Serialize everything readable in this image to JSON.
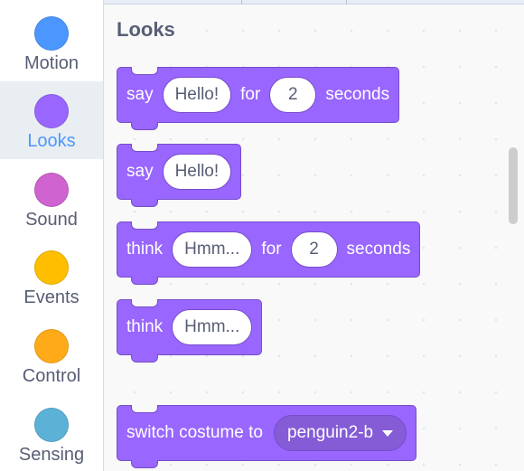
{
  "sidebar": {
    "categories": [
      {
        "label": "Motion",
        "color": "#4c97ff",
        "icon": "motion-dot-icon"
      },
      {
        "label": "Looks",
        "color": "#9966ff",
        "icon": "looks-dot-icon",
        "selected": true
      },
      {
        "label": "Sound",
        "color": "#cf63cf",
        "icon": "sound-dot-icon"
      },
      {
        "label": "Events",
        "color": "#ffbf00",
        "icon": "events-dot-icon"
      },
      {
        "label": "Control",
        "color": "#ffab19",
        "icon": "control-dot-icon"
      },
      {
        "label": "Sensing",
        "color": "#5cb1d6",
        "icon": "sensing-dot-icon"
      }
    ]
  },
  "palette": {
    "heading": "Looks",
    "block_color": "#9966ff",
    "blocks": {
      "say_for": {
        "word1": "say",
        "message": "Hello!",
        "word2": "for",
        "seconds": "2",
        "word3": "seconds"
      },
      "say": {
        "word1": "say",
        "message": "Hello!"
      },
      "think_for": {
        "word1": "think",
        "message": "Hmm...",
        "word2": "for",
        "seconds": "2",
        "word3": "seconds"
      },
      "think": {
        "word1": "think",
        "message": "Hmm..."
      },
      "switch_costume": {
        "text": "switch costume to",
        "costume": "penguin2-b"
      }
    }
  },
  "annotation": {
    "icon": "red-arrow-icon",
    "color": "#e0242b"
  }
}
